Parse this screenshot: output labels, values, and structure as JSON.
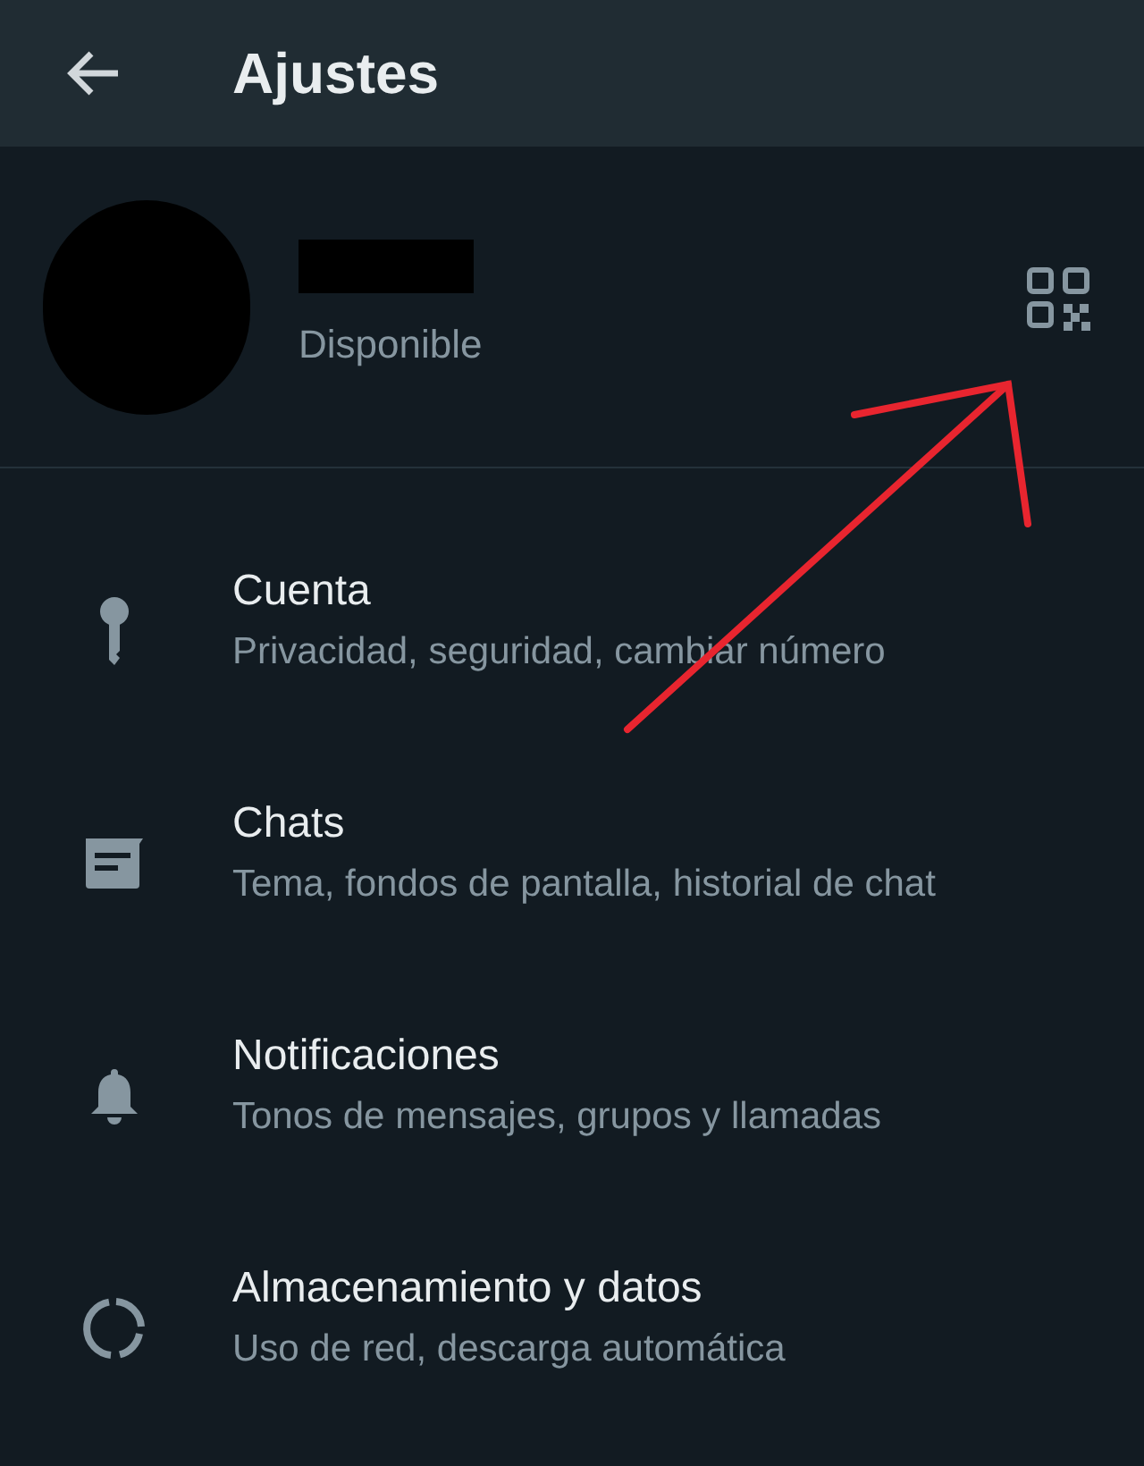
{
  "header": {
    "title": "Ajustes"
  },
  "profile": {
    "status": "Disponible"
  },
  "items": [
    {
      "kind": "key",
      "title": "Cuenta",
      "subtitle": "Privacidad, seguridad, cambiar número"
    },
    {
      "kind": "chat",
      "title": "Chats",
      "subtitle": "Tema, fondos de pantalla, historial de chat"
    },
    {
      "kind": "bell",
      "title": "Notificaciones",
      "subtitle": "Tonos de mensajes, grupos y llamadas"
    },
    {
      "kind": "storage",
      "title": "Almacenamiento y datos",
      "subtitle": "Uso de red, descarga automática"
    }
  ]
}
